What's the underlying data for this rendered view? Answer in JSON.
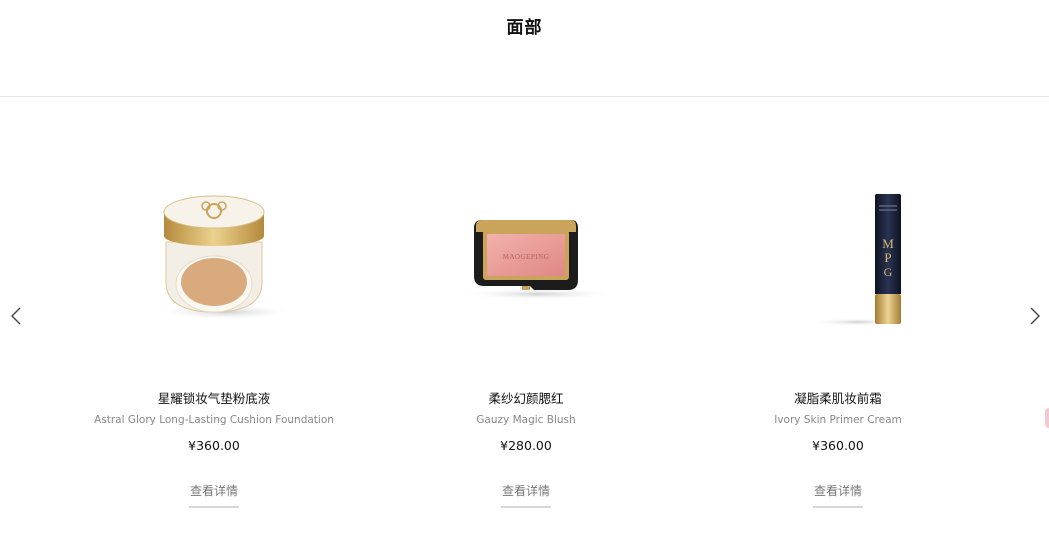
{
  "page": {
    "title": "面部"
  },
  "carousel": {
    "prev_icon": "chevron-left-icon",
    "next_icon": "chevron-right-icon"
  },
  "products": [
    {
      "name": "星耀锁妆气垫粉底液",
      "name_en": "Astral Glory Long-Lasting Cushion Foundation",
      "price": "¥360.00",
      "detail_label": "查看详情",
      "image": "cushion-compact-icon"
    },
    {
      "name": "柔纱幻颜腮红",
      "name_en": "Gauzy Magic Blush",
      "price": "¥280.00",
      "detail_label": "查看详情",
      "image": "blush-palette-icon"
    },
    {
      "name": "凝脂柔肌妆前霜",
      "name_en": "Ivory Skin Primer Cream",
      "price": "¥360.00",
      "detail_label": "查看详情",
      "image": "primer-tube-icon"
    }
  ],
  "colors": {
    "accent_gold": "#c9a45a",
    "blush_pink": "#e99a98",
    "tube_navy": "#1b2236"
  }
}
